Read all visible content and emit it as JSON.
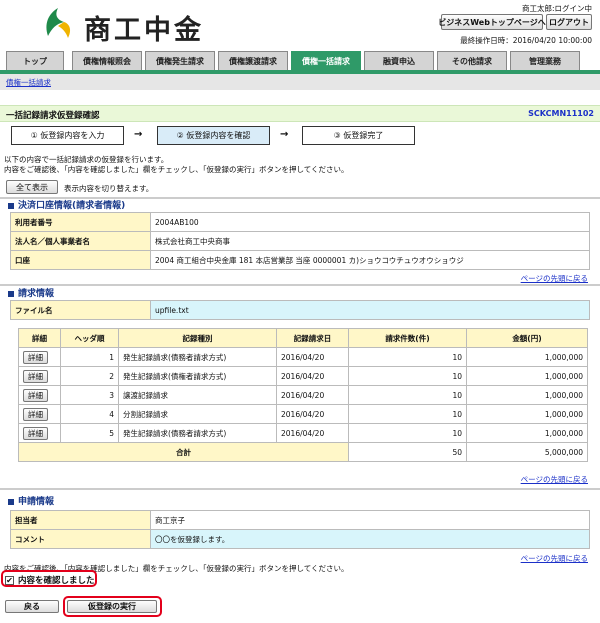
{
  "brand": {
    "name": "商工中金"
  },
  "header": {
    "user": "商工太郎:ログイン中",
    "top_page_button": "ビジネスWebトップページへ",
    "logout_button": "ログアウト",
    "last_op": "最終操作日時：2016/04/20 10:00:00"
  },
  "tabs": [
    "トップ",
    "債権情報照会",
    "債権発生請求",
    "債権譲渡請求",
    "債権一括請求",
    "融資申込",
    "その他請求",
    "管理業務"
  ],
  "breadcrumb": "債権一括請求",
  "page": {
    "title": "一括記録請求仮登録確認",
    "code": "SCKCMN11102"
  },
  "steps": [
    "① 仮登録内容を入力",
    "② 仮登録内容を確認",
    "③ 仮登録完了"
  ],
  "arrow": "→",
  "instructions": {
    "line1": "以下の内容で一括記録請求の仮登録を行います。",
    "line2": "内容をご確認後、「内容を確認しました」欄をチェックし、「仮登録の実行」ボタンを押してください。"
  },
  "show_all": {
    "button": "全て表示",
    "text": "表示内容を切り替えます。"
  },
  "settlement": {
    "title": "決済口座情報(請求者情報)",
    "rows": [
      {
        "label": "利用者番号",
        "value": "2004AB100"
      },
      {
        "label": "法人名／個人事業者名",
        "value": "株式会社商工中央商事"
      },
      {
        "label": "口座",
        "value": "2004 商工組合中央金庫 181 本店営業部 当座 0000001 カ)ショウコウチュウオウショウジ"
      }
    ]
  },
  "back_to_top": "ページの先頭に戻る",
  "request": {
    "title": "請求情報",
    "file_label": "ファイル名",
    "file_value": "upfile.txt",
    "headers": [
      "詳細",
      "ヘッダ順",
      "記録種別",
      "記録請求日",
      "請求件数(件)",
      "金額(円)"
    ],
    "detail_label": "詳細",
    "rows": [
      {
        "order": "1",
        "type": "発生記録請求(債務者請求方式)",
        "date": "2016/04/20",
        "count": "10",
        "amount": "1,000,000"
      },
      {
        "order": "2",
        "type": "発生記録請求(債権者請求方式)",
        "date": "2016/04/20",
        "count": "10",
        "amount": "1,000,000"
      },
      {
        "order": "3",
        "type": "譲渡記録請求",
        "date": "2016/04/20",
        "count": "10",
        "amount": "1,000,000"
      },
      {
        "order": "4",
        "type": "分割記録請求",
        "date": "2016/04/20",
        "count": "10",
        "amount": "1,000,000"
      },
      {
        "order": "5",
        "type": "発生記録請求(債務者請求方式)",
        "date": "2016/04/20",
        "count": "10",
        "amount": "1,000,000"
      }
    ],
    "total_label": "合計",
    "total_count": "50",
    "total_amount": "5,000,000"
  },
  "application": {
    "title": "申請情報",
    "rows": [
      {
        "label": "担当者",
        "value": "商工京子"
      },
      {
        "label": "コメント",
        "value": "〇〇を仮登録します。"
      }
    ]
  },
  "confirm": {
    "instruction": "内容をご確認後、「内容を確認しました」欄をチェックし、「仮登録の実行」ボタンを押してください。",
    "checkbox_label": "内容を確認しました",
    "checked": true
  },
  "buttons": {
    "back": "戻る",
    "execute": "仮登録の実行"
  }
}
